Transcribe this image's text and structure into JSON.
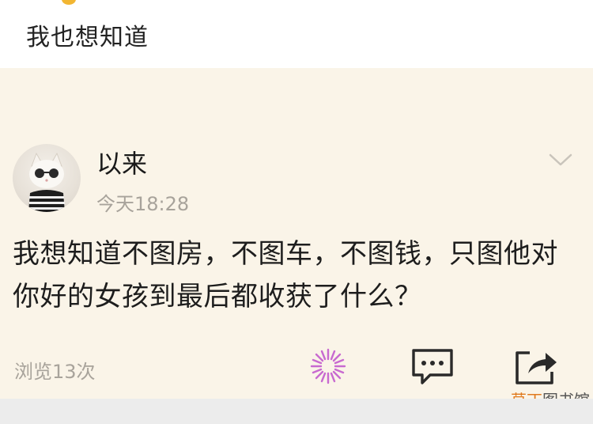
{
  "caption": "我也想知道",
  "post": {
    "username": "以来",
    "timestamp": "今天18:28",
    "text": "我想知道不图房，不图车，不图钱，只图他对你好的女孩到最后都收获了什么？",
    "views": "浏览13次"
  },
  "icons": {
    "avatar": "cat-with-sunglasses-avatar",
    "menu": "chevron-down-icon",
    "like": "spark-icon",
    "comment": "comment-icon",
    "share": "share-icon"
  },
  "watermark": {
    "accent": "草丁",
    "rest": "图书馆"
  },
  "colors": {
    "card_background": "#faf4e8",
    "muted_text": "#a8a39b",
    "spark": "#c86ad0",
    "watermark_accent": "#e07a1f"
  }
}
